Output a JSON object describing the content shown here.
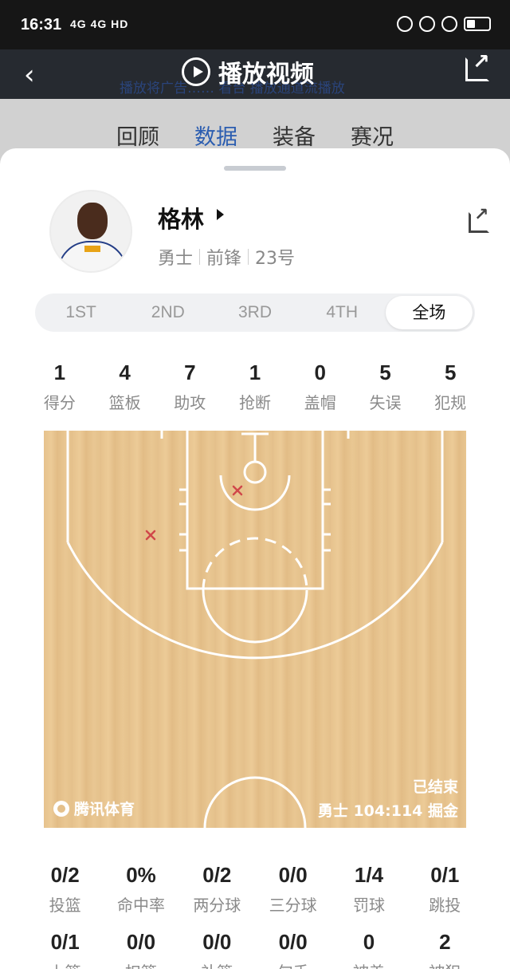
{
  "status": {
    "time": "16:31",
    "signal": "4G 4G HD"
  },
  "header": {
    "title": "播放视频",
    "bg_text": "播放将广告…… 看台 播放通道流播放"
  },
  "tabs": [
    {
      "label": "回顾",
      "active": false
    },
    {
      "label": "数据",
      "active": true
    },
    {
      "label": "装备",
      "active": false
    },
    {
      "label": "赛况",
      "active": false
    }
  ],
  "player": {
    "name": "格林",
    "team": "勇士",
    "position": "前锋",
    "number": "23号"
  },
  "periods": [
    {
      "label": "1ST",
      "active": false
    },
    {
      "label": "2ND",
      "active": false
    },
    {
      "label": "3RD",
      "active": false
    },
    {
      "label": "4TH",
      "active": false
    },
    {
      "label": "全场",
      "active": true
    }
  ],
  "summary": [
    {
      "value": "1",
      "label": "得分"
    },
    {
      "value": "4",
      "label": "篮板"
    },
    {
      "value": "7",
      "label": "助攻"
    },
    {
      "value": "1",
      "label": "抢断"
    },
    {
      "value": "0",
      "label": "盖帽"
    },
    {
      "value": "5",
      "label": "失误"
    },
    {
      "value": "5",
      "label": "犯规"
    }
  ],
  "court": {
    "status": "已结束",
    "score": "勇士 104:114 掘金",
    "brand": "腾讯体育",
    "shots": [
      {
        "result": "miss",
        "color": "#d0474a"
      },
      {
        "result": "miss",
        "color": "#d0474a"
      }
    ]
  },
  "stats_row1": [
    {
      "value": "0/2",
      "label": "投篮"
    },
    {
      "value": "0%",
      "label": "命中率"
    },
    {
      "value": "0/2",
      "label": "两分球"
    },
    {
      "value": "0/0",
      "label": "三分球"
    },
    {
      "value": "1/4",
      "label": "罚球"
    },
    {
      "value": "0/1",
      "label": "跳投"
    }
  ],
  "stats_row2": [
    {
      "value": "0/1",
      "label": "上篮"
    },
    {
      "value": "0/0",
      "label": "扣篮"
    },
    {
      "value": "0/0",
      "label": "补篮"
    },
    {
      "value": "0/0",
      "label": "勾手"
    },
    {
      "value": "0",
      "label": "被盖"
    },
    {
      "value": "2",
      "label": "被犯"
    }
  ],
  "colors": {
    "accent": "#2b5db0",
    "court": "#e6c28d",
    "miss_mark": "#d0474a"
  }
}
